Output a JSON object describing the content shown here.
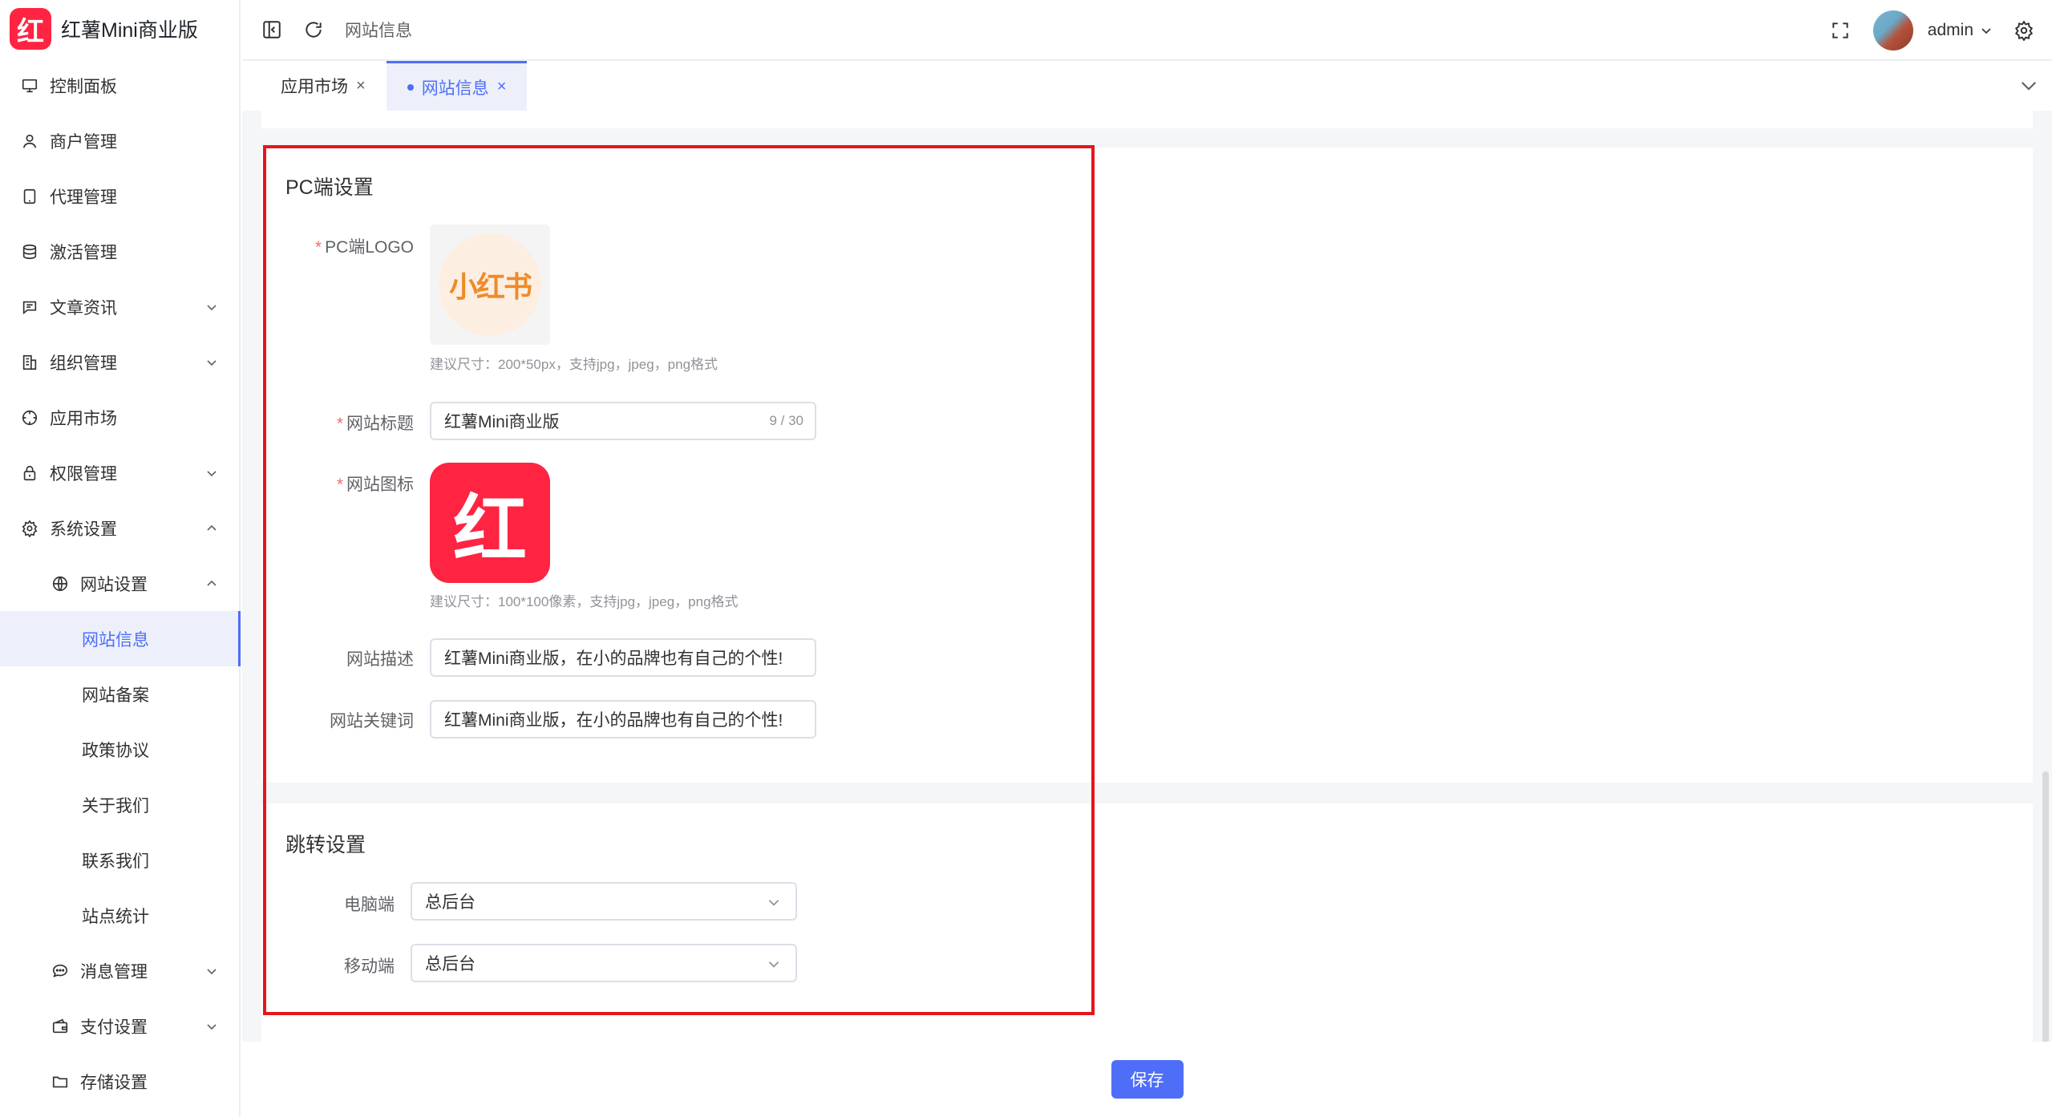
{
  "app": {
    "logo_glyph": "红",
    "title": "红薯Mini商业版"
  },
  "sidebar": {
    "items": [
      {
        "label": "控制面板",
        "icon": "monitor-icon"
      },
      {
        "label": "商户管理",
        "icon": "user-icon"
      },
      {
        "label": "代理管理",
        "icon": "tablet-icon"
      },
      {
        "label": "激活管理",
        "icon": "database-icon"
      },
      {
        "label": "文章资讯",
        "icon": "message-icon"
      },
      {
        "label": "组织管理",
        "icon": "building-icon"
      },
      {
        "label": "应用市场",
        "icon": "compass-icon"
      },
      {
        "label": "权限管理",
        "icon": "lock-icon"
      },
      {
        "label": "系统设置",
        "icon": "gear-icon"
      }
    ],
    "website_settings": {
      "label": "网站设置",
      "icon": "basketball-icon"
    },
    "website_sub": [
      "网站信息",
      "网站备案",
      "政策协议",
      "关于我们",
      "联系我们",
      "站点统计"
    ],
    "message_mgmt": {
      "label": "消息管理",
      "icon": "chat-icon"
    },
    "payment": {
      "label": "支付设置",
      "icon": "wallet-icon"
    },
    "storage": {
      "label": "存储设置",
      "icon": "folder-icon"
    }
  },
  "header": {
    "breadcrumb": "网站信息",
    "user": "admin"
  },
  "tabs": [
    {
      "label": "应用市场",
      "active": false
    },
    {
      "label": "网站信息",
      "active": true
    }
  ],
  "pc_section": {
    "title": "PC端设置",
    "logo_label": "PC端LOGO",
    "logo_text": "小红书",
    "logo_hint": "建议尺寸：200*50px，支持jpg，jpeg，png格式",
    "site_title_label": "网站标题",
    "site_title_value": "红薯Mini商业版",
    "site_title_counter": "9 / 30",
    "icon_label": "网站图标",
    "icon_glyph": "红",
    "icon_hint": "建议尺寸：100*100像素，支持jpg，jpeg，png格式",
    "desc_label": "网站描述",
    "desc_value": "红薯Mini商业版，在小的品牌也有自己的个性!",
    "keywords_label": "网站关键词",
    "keywords_value": "红薯Mini商业版，在小的品牌也有自己的个性!"
  },
  "redirect_section": {
    "title": "跳转设置",
    "pc_label": "电脑端",
    "pc_value": "总后台",
    "mobile_label": "移动端",
    "mobile_value": "总后台"
  },
  "footer": {
    "save_label": "保存"
  },
  "colors": {
    "accent": "#4f6ef7",
    "brand": "#ff2442",
    "highlight": "#e8141b"
  }
}
